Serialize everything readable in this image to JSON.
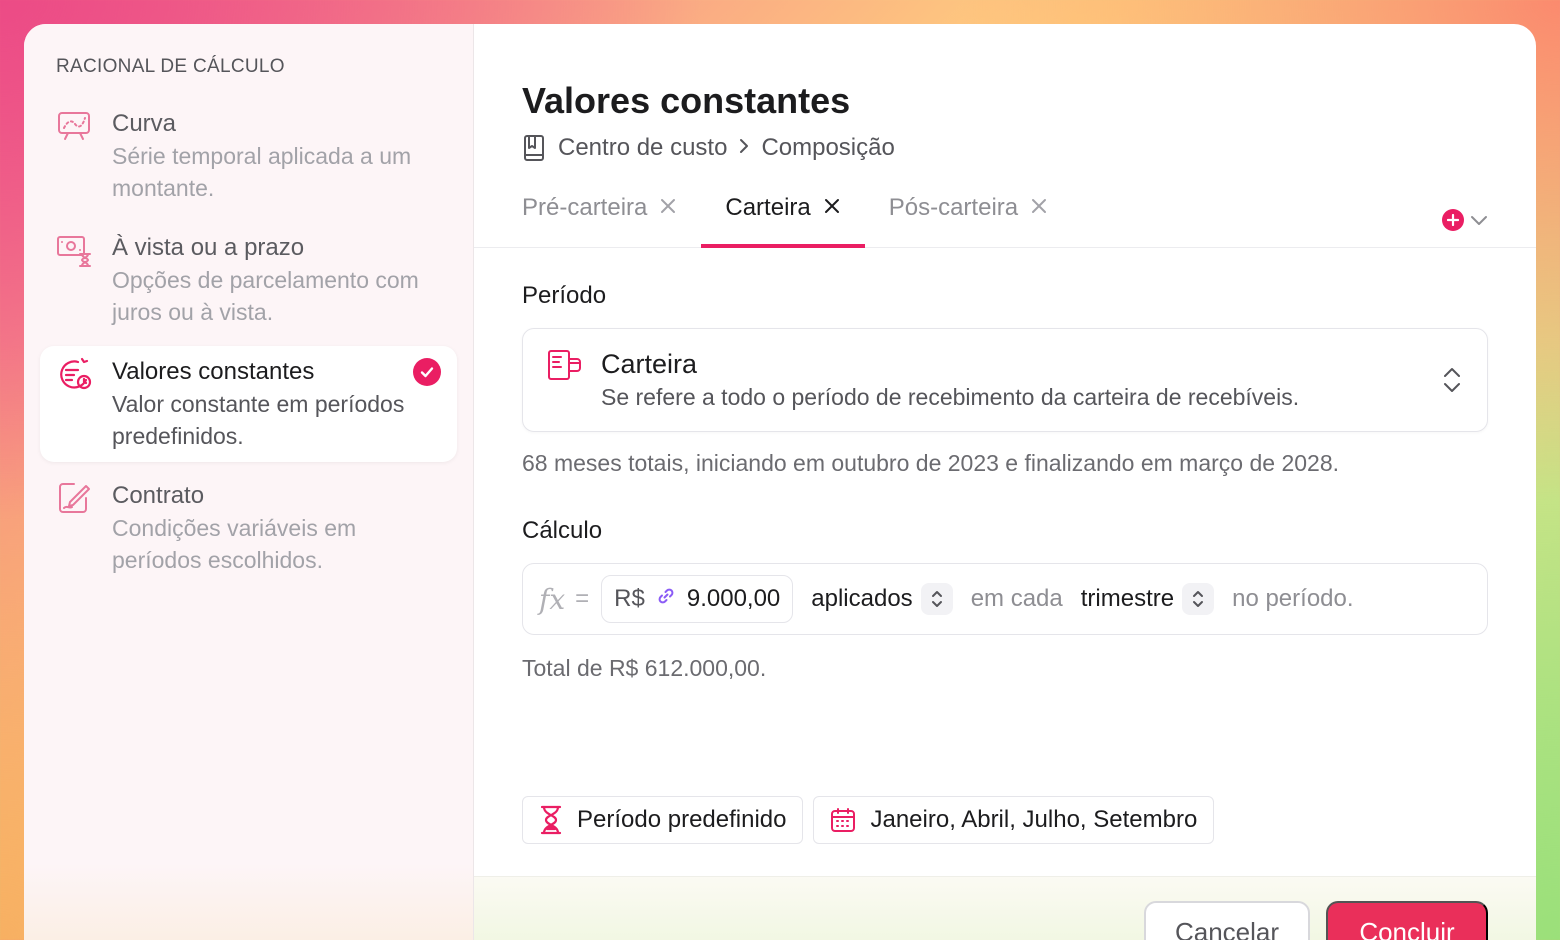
{
  "sidebar": {
    "heading": "RACIONAL DE CÁLCULO",
    "options": [
      {
        "title": "Curva",
        "description": "Série temporal aplicada a um montante.",
        "icon": "presentation-chart-icon",
        "selected": false
      },
      {
        "title": "À vista ou a prazo",
        "description": "Opções de parcelamento com juros ou à vista.",
        "icon": "money-hourglass-icon",
        "selected": false
      },
      {
        "title": "Valores constantes",
        "description": "Valor constante em períodos predefinidos.",
        "icon": "list-timer-icon",
        "selected": true
      },
      {
        "title": "Contrato",
        "description": "Condições variáveis em períodos escolhidos.",
        "icon": "contract-pen-icon",
        "selected": false
      }
    ]
  },
  "main": {
    "title": "Valores constantes",
    "breadcrumb": [
      "Centro de custo",
      "Composição"
    ],
    "tabs": [
      {
        "label": "Pré-carteira",
        "active": false
      },
      {
        "label": "Carteira",
        "active": true
      },
      {
        "label": "Pós-carteira",
        "active": false
      }
    ],
    "periodo": {
      "label": "Período",
      "selected_title": "Carteira",
      "selected_description": "Se refere a todo o período de recebimento da carteira de recebíveis.",
      "note": "68 meses totais, iniciando em outubro de 2023 e finalizando em março de 2028."
    },
    "calculo": {
      "label": "Cálculo",
      "fx": "fx",
      "equals": "=",
      "currency": "R$",
      "amount": "9.000,00",
      "mode": "aplicados",
      "connector": "em cada",
      "frequency": "trimestre",
      "suffix": "no período.",
      "total": "Total de R$ 612.000,00."
    },
    "chips": [
      {
        "label": "Período predefinido",
        "icon": "hourglass-icon"
      },
      {
        "label": "Janeiro, Abril, Julho, Setembro",
        "icon": "calendar-icon"
      }
    ],
    "footer": {
      "cancel_label": "Cancelar",
      "confirm_label": "Concluir"
    }
  },
  "colors": {
    "accent": "#ea1e63",
    "link": "#8b5cf6"
  }
}
